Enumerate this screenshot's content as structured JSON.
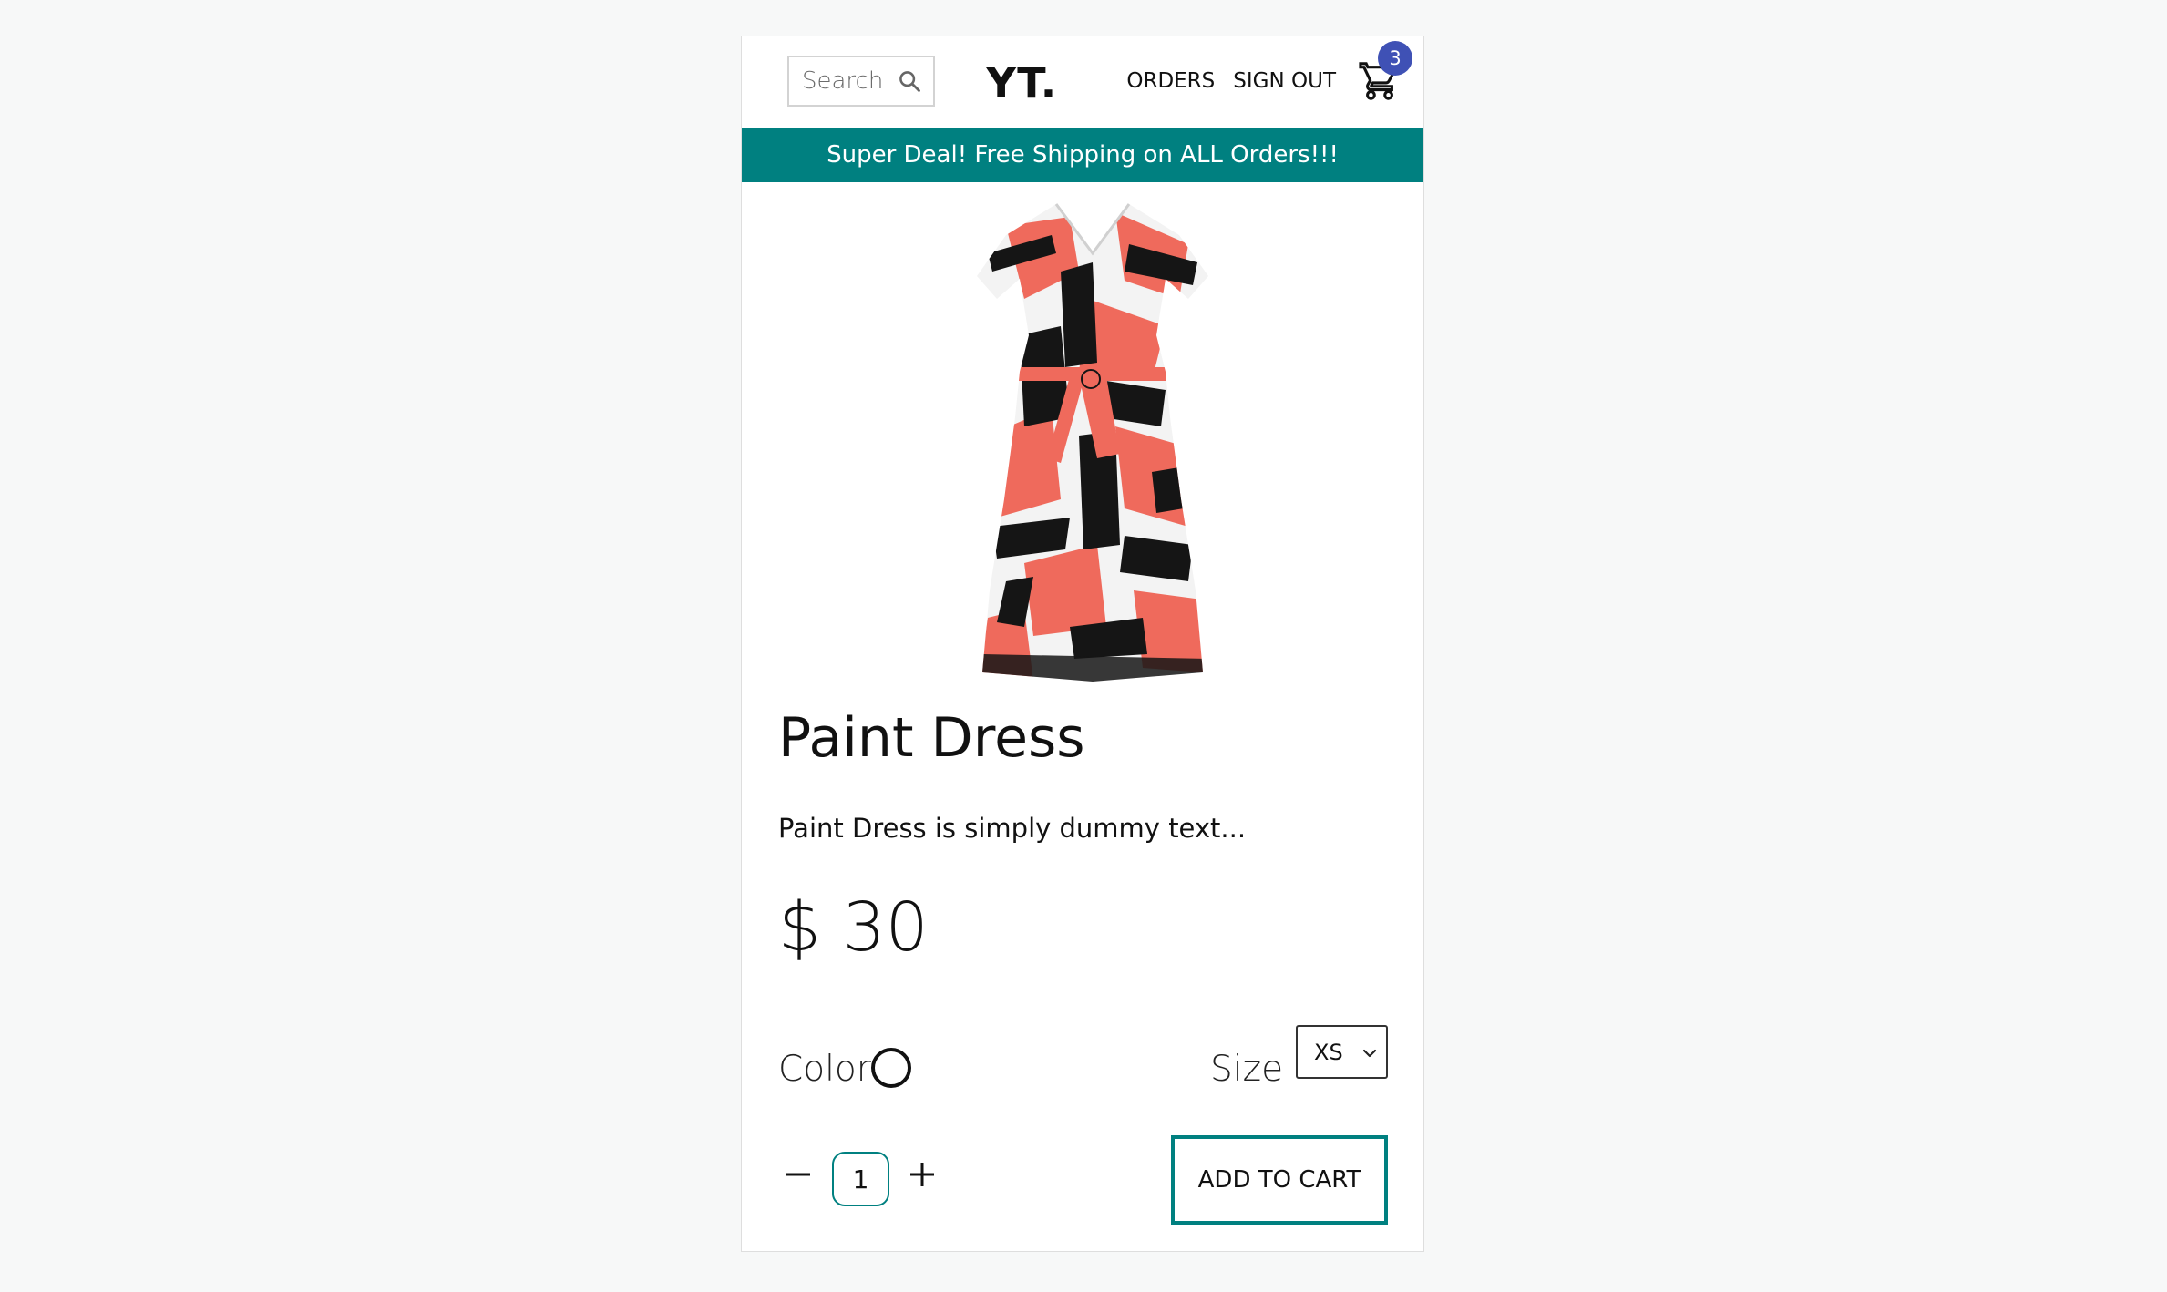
{
  "navbar": {
    "search_placeholder": "Search",
    "search_icon": "search-icon",
    "logo": "YT.",
    "links": [
      "ORDERS",
      "SIGN OUT"
    ],
    "cart_icon": "shopping-cart-icon",
    "cart_count": "3",
    "badge_color": "#3f51b5"
  },
  "announcement": {
    "text": "Super Deal! Free Shipping on ALL Orders!!!",
    "background": "#008080"
  },
  "product": {
    "image_alt": "Paint dress with red, black and white brush stroke pattern",
    "title": "Paint Dress",
    "description": "Paint Dress is simply dummy text...",
    "price": "$ 30",
    "color_label": "Color",
    "size_label": "Size",
    "selected_size": "XS",
    "quantity": "1",
    "add_to_cart_label": "ADD TO CART",
    "accent": "#008080"
  }
}
